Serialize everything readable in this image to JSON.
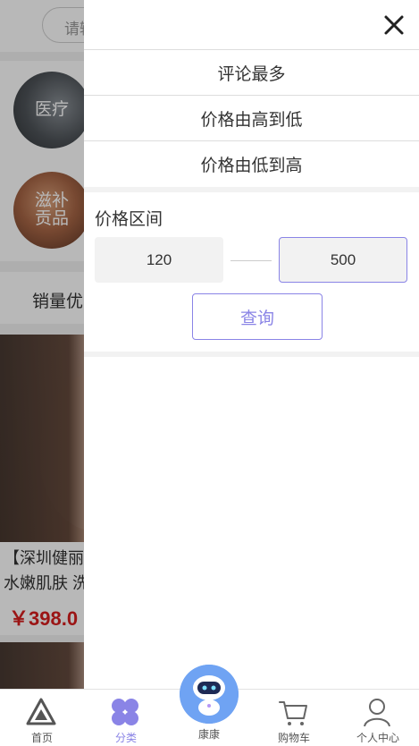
{
  "background_page": {
    "search_placeholder": "请输",
    "categories": [
      {
        "label": "医疗"
      },
      {
        "label": "滋补\n贡品"
      }
    ],
    "sort_label": "销量优",
    "product": {
      "title_line1": "【深圳健丽",
      "title_line2": "水嫩肌肤 洗",
      "price": "￥398.0"
    }
  },
  "drawer": {
    "sort_options": [
      "评论最多",
      "价格由高到低",
      "价格由低到高"
    ],
    "price_range": {
      "title": "价格区间",
      "min_value": "120",
      "max_value": "500",
      "query_label": "查询"
    },
    "accent_color": "#8a84e6"
  },
  "tabbar": {
    "items": [
      {
        "label": "首页",
        "icon": "home-triangle-icon"
      },
      {
        "label": "分类",
        "icon": "category-clover-icon",
        "active": true
      },
      {
        "label": "康康",
        "icon": "robot-assistant-icon"
      },
      {
        "label": "购物车",
        "icon": "cart-icon"
      },
      {
        "label": "个人中心",
        "icon": "user-icon"
      }
    ]
  }
}
